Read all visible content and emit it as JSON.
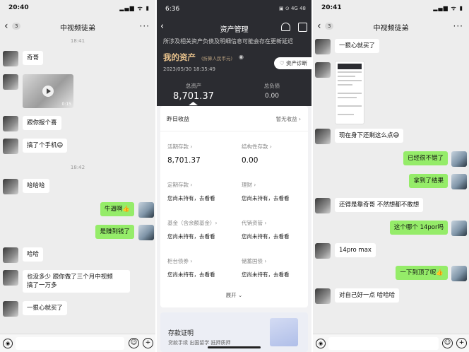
{
  "left": {
    "status": {
      "time": "20:40",
      "icons": "▂▄▆ ᯤ ▮"
    },
    "nav": {
      "back": "‹",
      "count": "3",
      "title": "中视频徒弟",
      "more": "···"
    },
    "timestamps": [
      "18:41",
      "18:42"
    ],
    "video_duration": "0:15",
    "messages": [
      {
        "side": "in",
        "text": "奇哥"
      },
      {
        "side": "in",
        "text": "跟你报个喜"
      },
      {
        "side": "in",
        "text": "搞了个手机😄"
      },
      {
        "side": "in",
        "text": "哈哈哈"
      },
      {
        "side": "out",
        "text": "牛逼啊👍"
      },
      {
        "side": "out",
        "text": "是赚到钱了"
      },
      {
        "side": "in",
        "text": "哈哈"
      },
      {
        "side": "in",
        "text": "也没多少 跟你做了三个月中视频"
      },
      {
        "side": "in",
        "text": "搞了一万多"
      },
      {
        "side": "in",
        "text": "一狠心就买了"
      }
    ]
  },
  "middle": {
    "status": {
      "time": "6:36",
      "icons": "▣ ⊙ 4G 48"
    },
    "title": "资产管理",
    "notice": "所涉及相关资产负债及明细信息可能会存在更新延迟",
    "my_assets": "我的资产",
    "unit": "(折算人民币元)",
    "date": "2023/05/30 18:35:49",
    "diagnosis": "资产诊断",
    "total_assets_label": "总资产",
    "total_assets": "8,701.37",
    "total_liab_label": "总负债",
    "total_liab": "0.00",
    "yesterday_label": "昨日收益",
    "yesterday_value": "暂无收益 ›",
    "cells": [
      {
        "k": "活期存款 ›",
        "v": "8,701.37"
      },
      {
        "k": "结构性存款 ›",
        "v": "0.00"
      },
      {
        "k": "定期存款 ›",
        "v": "您尚未持有，去看看"
      },
      {
        "k": "理财 ›",
        "v": "您尚未持有，去看看"
      },
      {
        "k": "基金（含余额基金）›",
        "v": "您尚未持有，去看看"
      },
      {
        "k": "代销资管 ›",
        "v": "您尚未持有，去看看"
      },
      {
        "k": "柜台债券 ›",
        "v": "您尚未持有，去看看"
      },
      {
        "k": "储蓄国债 ›",
        "v": "您尚未持有，去看看"
      }
    ],
    "expand": "展开 ⌄",
    "proof_title": "存款证明",
    "proof_sub": "贷款手续 出国留学 抵押质押"
  },
  "right": {
    "status": {
      "time": "20:41",
      "icons": "▂▄▆ ᯤ ▮"
    },
    "nav": {
      "back": "‹",
      "count": "3",
      "title": "中视频徒弟",
      "more": "···"
    },
    "messages": [
      {
        "side": "in",
        "text": "一狠心就买了"
      },
      {
        "side": "in",
        "text": "现在身下还剩这么点😅"
      },
      {
        "side": "out",
        "text": "已经很不错了"
      },
      {
        "side": "out",
        "text": "拿到了结果"
      },
      {
        "side": "in",
        "text": "还得是靠奇哥 不然想都不敢想"
      },
      {
        "side": "out",
        "text": "这个哪个 14por吗"
      },
      {
        "side": "in",
        "text": "14pro max"
      },
      {
        "side": "out",
        "text": "一下到顶了呢👍"
      },
      {
        "side": "in",
        "text": "对自己好一点 哈哈哈"
      }
    ]
  },
  "colors": {
    "out_bubble": "#95ec69",
    "chat_bg": "#ededed",
    "asset_header": "#2b2c31",
    "gold": "#e6c08b"
  }
}
